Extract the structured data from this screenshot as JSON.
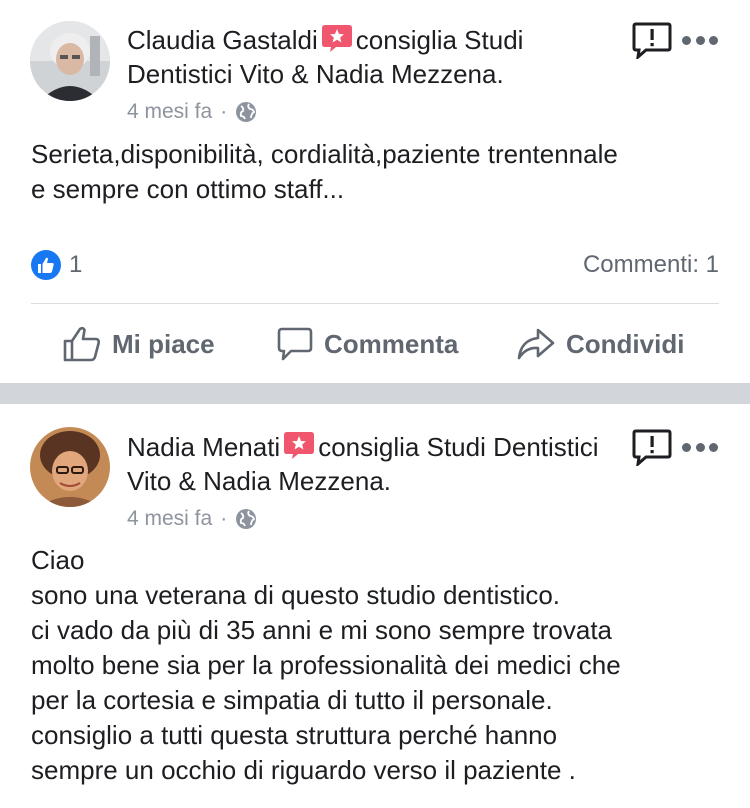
{
  "posts": [
    {
      "author": "Claudia Gastaldi",
      "action_text": "consiglia Studi Dentistici Vito & Nadia Mezzena.",
      "time": "4 mesi fa",
      "meta_separator": "·",
      "text": "Serieta,disponibilità, cordialità,paziente trentennale\ne sempre con ottimo staff...",
      "likes": "1",
      "comments": "Commenti: 1"
    },
    {
      "author": "Nadia Menati",
      "action_text": "consiglia Studi Dentistici Vito & Nadia Mezzena.",
      "time": "4 mesi fa",
      "meta_separator": "·",
      "text": "Ciao\nsono una veterana di questo studio dentistico.\nci vado da più di 35 anni e mi sono sempre trovata\nmolto bene sia per la professionalità dei medici che\nper la cortesia e simpatia di tutto il personale.\nconsiglio a tutti questa struttura perché  hanno\nsempre un occhio di riguardo verso il paziente ."
    }
  ],
  "actions": {
    "like": "Mi piace",
    "comment": "Commenta",
    "share": "Condividi"
  },
  "colors": {
    "recommend_badge": "#f0566e",
    "like_blue": "#1877f2",
    "separator": "#d2d5da",
    "secondary_text": "#8d949e"
  },
  "icons": [
    "recommend-icon",
    "globe-icon",
    "report-icon",
    "more-icon",
    "like-icon",
    "comment-icon",
    "share-icon"
  ]
}
